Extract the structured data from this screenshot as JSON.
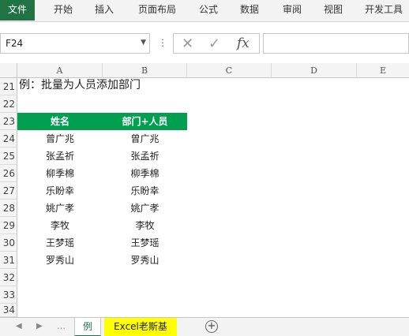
{
  "ribbon": {
    "tabs": [
      "文件",
      "开始",
      "插入",
      "页面布局",
      "公式",
      "数据",
      "审阅",
      "视图",
      "开发工具"
    ]
  },
  "formula_bar": {
    "name_box": "F24",
    "cancel_icon": "close-icon",
    "enter_icon": "check-icon",
    "function_label": "fx",
    "formula": ""
  },
  "grid": {
    "columns": [
      "A",
      "B",
      "C",
      "D",
      "E"
    ],
    "rows": [
      "21",
      "22",
      "23",
      "24",
      "25",
      "26",
      "27",
      "28",
      "29",
      "30",
      "31",
      "32",
      "33",
      "34"
    ],
    "title": "例：批量为人员添加部门",
    "table_headers": [
      "姓名",
      "部门+人员"
    ],
    "table_rows": [
      [
        "曾广兆",
        "曾广兆"
      ],
      [
        "张孟祈",
        "张孟祈"
      ],
      [
        "柳季棉",
        "柳季棉"
      ],
      [
        "乐盼幸",
        "乐盼幸"
      ],
      [
        "姚广孝",
        "姚广孝"
      ],
      [
        "李牧",
        "李牧"
      ],
      [
        "王梦瑶",
        "王梦瑶"
      ],
      [
        "罗秀山",
        "罗秀山"
      ]
    ],
    "header_color": "#00a050"
  },
  "sheets": {
    "tabs": [
      "例",
      "Excel老斯基"
    ],
    "active": "例",
    "highlight_color": "#ffff00"
  }
}
